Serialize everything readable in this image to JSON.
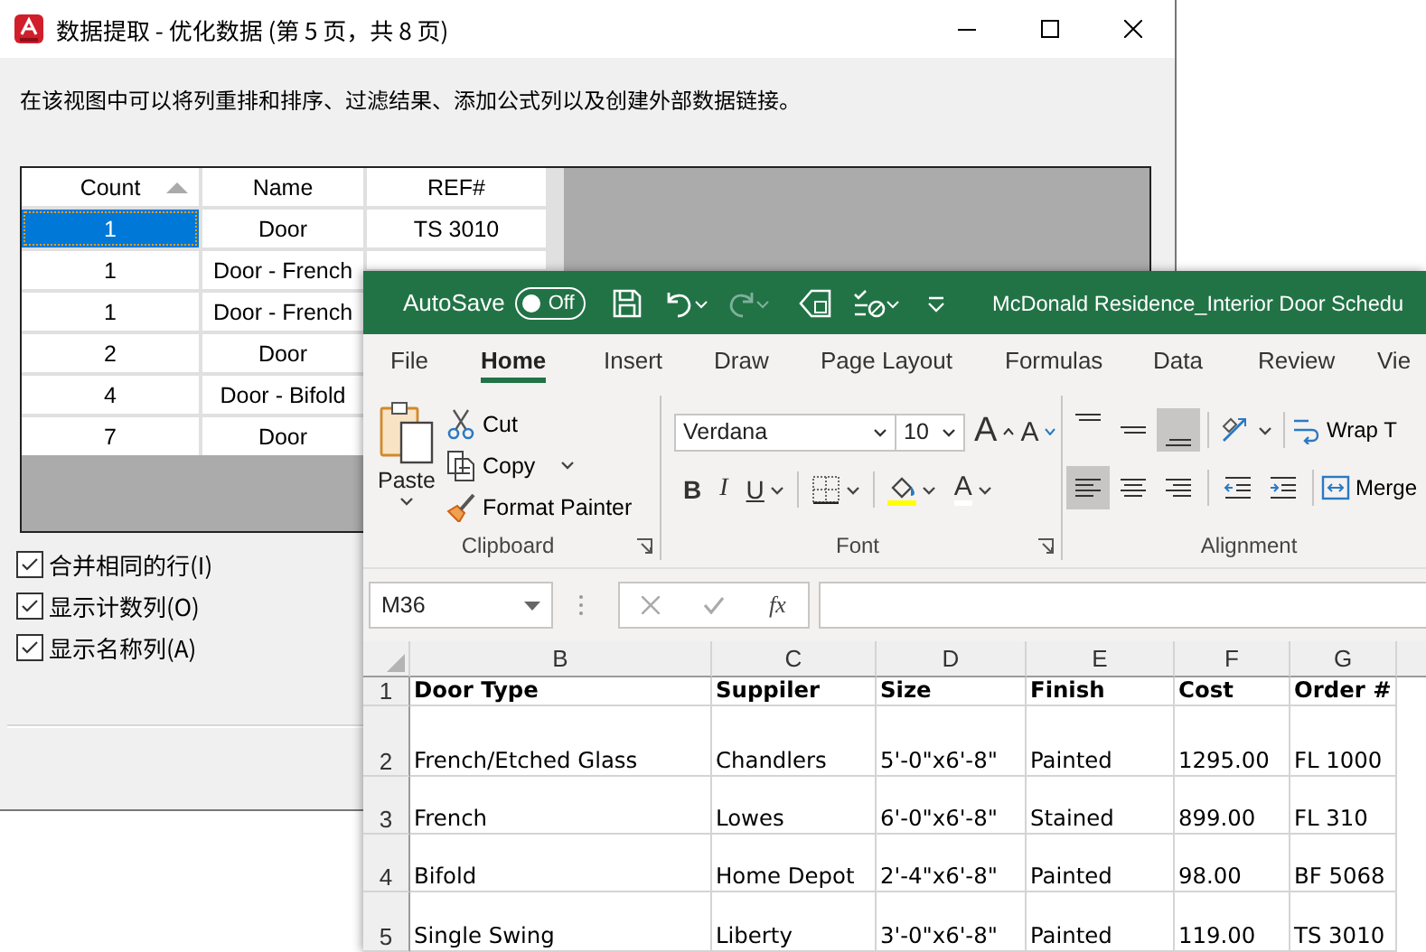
{
  "dialog": {
    "title": "数据提取 - 优化数据 (第 5 页，共 8 页)",
    "description": "在该视图中可以将列重排和排序、过滤结果、添加公式列以及创建外部数据链接。",
    "table": {
      "columns": [
        {
          "label": "Count",
          "sorted": true
        },
        {
          "label": "Name",
          "sorted": false
        },
        {
          "label": "REF#",
          "sorted": false
        }
      ],
      "rows": [
        {
          "count": "1",
          "name": "Door",
          "ref": "TS 3010",
          "selected": true
        },
        {
          "count": "1",
          "name": "Door - French",
          "selected": false
        },
        {
          "count": "1",
          "name": "Door - French",
          "selected": false
        },
        {
          "count": "2",
          "name": "Door",
          "selected": false
        },
        {
          "count": "4",
          "name": "Door - Bifold",
          "selected": false
        },
        {
          "count": "7",
          "name": "Door",
          "selected": false
        }
      ]
    },
    "checkboxes": [
      {
        "label": "合并相同的行(I)",
        "checked": true
      },
      {
        "label": "显示计数列(O)",
        "checked": true
      },
      {
        "label": "显示名称列(A)",
        "checked": true
      }
    ]
  },
  "excel": {
    "autosave": {
      "label": "AutoSave",
      "on": false,
      "state": "Off"
    },
    "title": "McDonald Residence_Interior Door Schedu",
    "tabs": [
      {
        "label": "File",
        "selected": false
      },
      {
        "label": "Home",
        "selected": true
      },
      {
        "label": "Insert",
        "selected": false
      },
      {
        "label": "Draw",
        "selected": false
      },
      {
        "label": "Page Layout",
        "selected": false
      },
      {
        "label": "Formulas",
        "selected": false
      },
      {
        "label": "Data",
        "selected": false
      },
      {
        "label": "Review",
        "selected": false
      },
      {
        "label": "Vie",
        "selected": false
      }
    ],
    "clipboard": {
      "group": "Clipboard",
      "paste": "Paste",
      "cut": "Cut",
      "copy": "Copy",
      "format_painter": "Format Painter"
    },
    "font": {
      "group": "Font",
      "name": "Verdana",
      "size": "10",
      "grow": "A",
      "shrink": "A",
      "bold": "B",
      "italic": "I",
      "underline": "U",
      "font_color_glyph": "A"
    },
    "alignment": {
      "group": "Alignment",
      "wrap": "Wrap T",
      "merge": "Merge",
      "buttons": [
        {
          "kind": "top",
          "selected": false
        },
        {
          "kind": "middle",
          "selected": false
        },
        {
          "kind": "bottom",
          "selected": true
        },
        {
          "kind": "left",
          "selected": true
        },
        {
          "kind": "center",
          "selected": false
        },
        {
          "kind": "right",
          "selected": false
        }
      ]
    },
    "formula_bar": {
      "name_box": "M36",
      "function": "fx"
    },
    "sheet": {
      "columns": [
        "B",
        "C",
        "D",
        "E",
        "F",
        "G"
      ],
      "rows": [
        {
          "number": "1",
          "header": true,
          "cells": [
            "Door Type",
            "Suppiler",
            "Size",
            "Finish",
            "Cost",
            "Order #"
          ]
        },
        {
          "number": "2",
          "header": false,
          "cells": [
            "French/Etched Glass",
            "Chandlers",
            "5'-0\"x6'-8\"",
            "Painted",
            "1295.00",
            "FL 1000"
          ]
        },
        {
          "number": "3",
          "header": false,
          "cells": [
            "French",
            "Lowes",
            "6'-0\"x6'-8\"",
            "Stained",
            "899.00",
            "FL 310"
          ]
        },
        {
          "number": "4",
          "header": false,
          "cells": [
            "Bifold",
            "Home Depot",
            "2'-4\"x6'-8\"",
            "Painted",
            "98.00",
            "BF 5068"
          ]
        },
        {
          "number": "5",
          "header": false,
          "cells": [
            "Single Swing",
            "Liberty",
            "3'-0\"x6'-8\"",
            "Painted",
            "119.00",
            "TS 3010"
          ]
        }
      ]
    }
  }
}
